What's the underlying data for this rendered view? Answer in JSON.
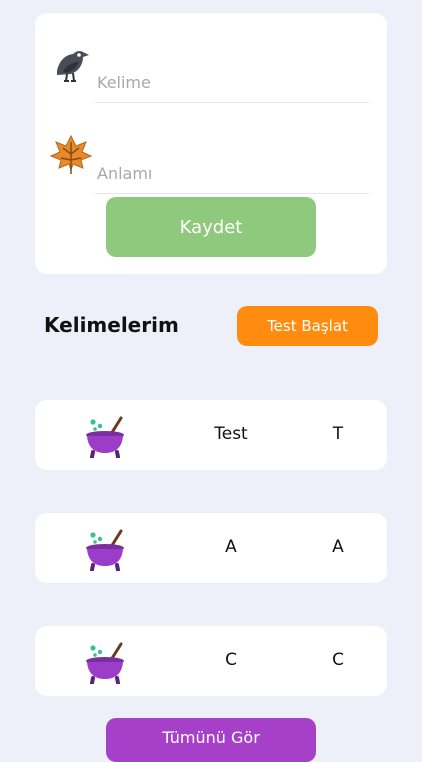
{
  "form": {
    "word_placeholder": "Kelime",
    "meaning_placeholder": "Anlamı",
    "word_icon": "crow-icon",
    "meaning_icon": "leaf-icon",
    "save_label": "Kaydet"
  },
  "section": {
    "title": "Kelimelerim",
    "start_test_label": "Test Başlat"
  },
  "words": [
    {
      "word": "Test",
      "meaning": "T",
      "icon": "cauldron-icon"
    },
    {
      "word": "A",
      "meaning": "A",
      "icon": "cauldron-icon"
    },
    {
      "word": "C",
      "meaning": "C",
      "icon": "cauldron-icon"
    }
  ],
  "footer": {
    "view_all_label": "Tümünü Gör"
  },
  "colors": {
    "background": "#edf0f8",
    "save_button": "#8fc97e",
    "start_test_button": "#ff8c0f",
    "view_all_button": "#a740c8"
  }
}
